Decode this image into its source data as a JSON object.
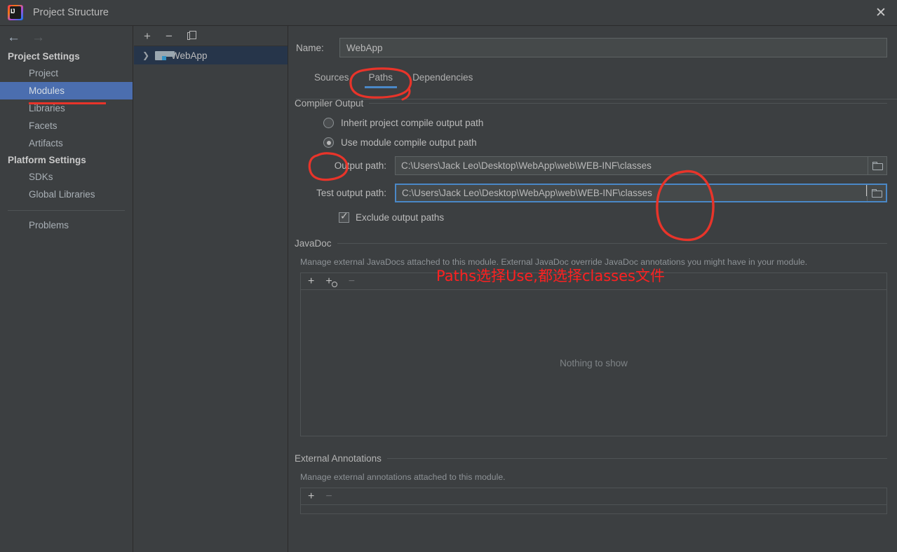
{
  "window": {
    "title": "Project Structure",
    "logo_icon": "intellij-idea-logo",
    "close_icon": "close-icon"
  },
  "sidebar": {
    "back_icon": "arrow-left-icon",
    "forward_icon": "arrow-right-icon",
    "groups": [
      {
        "label": "Project Settings",
        "items": [
          {
            "label": "Project",
            "selected": false
          },
          {
            "label": "Modules",
            "selected": true
          },
          {
            "label": "Libraries",
            "selected": false
          },
          {
            "label": "Facets",
            "selected": false
          },
          {
            "label": "Artifacts",
            "selected": false
          }
        ]
      },
      {
        "label": "Platform Settings",
        "items": [
          {
            "label": "SDKs",
            "selected": false
          },
          {
            "label": "Global Libraries",
            "selected": false
          }
        ]
      }
    ],
    "problems_label": "Problems"
  },
  "tree_panel": {
    "toolbar": {
      "add_icon": "plus-icon",
      "remove_icon": "minus-icon",
      "copy_icon": "copy-icon"
    },
    "nodes": [
      {
        "label": "WebApp",
        "expand_icon": "chevron-right-icon",
        "module_icon": "module-folder-icon",
        "selected": true
      }
    ]
  },
  "main": {
    "name_label": "Name:",
    "name_value": "WebApp",
    "tabs": [
      {
        "label": "Sources",
        "active": false
      },
      {
        "label": "Paths",
        "active": true
      },
      {
        "label": "Dependencies",
        "active": false
      }
    ],
    "compiler_output": {
      "title": "Compiler Output",
      "options": [
        {
          "label": "Inherit project compile output path",
          "selected": false
        },
        {
          "label": "Use module compile output path",
          "selected": true
        }
      ],
      "output_path": {
        "label": "Output path:",
        "value": "C:\\Users\\Jack Leo\\Desktop\\WebApp\\web\\WEB-INF\\classes",
        "focused": false,
        "browse_icon": "folder-browse-icon"
      },
      "test_output_path": {
        "label": "Test output path:",
        "value": "C:\\Users\\Jack Leo\\Desktop\\WebApp\\web\\WEB-INF\\classes",
        "focused": true,
        "browse_icon": "folder-browse-icon"
      },
      "exclude_checkbox": {
        "label": "Exclude output paths",
        "checked": true
      }
    },
    "javadoc": {
      "title": "JavaDoc",
      "description": "Manage external JavaDocs attached to this module. External JavaDoc override JavaDoc annotations you might have in your module.",
      "toolbar": {
        "add_icon": "plus-icon",
        "add_url_icon": "plus-globe-icon",
        "remove_icon": "minus-icon"
      },
      "empty_text": "Nothing to show"
    },
    "external_annotations": {
      "title": "External Annotations",
      "description": "Manage external annotations attached to this module.",
      "toolbar": {
        "add_icon": "plus-icon",
        "remove_icon": "minus-icon"
      }
    }
  },
  "annotations": {
    "color": "#ff2020",
    "note_text": "Paths选择Use,都选择classes文件",
    "circles": [
      "paths-tab-circle",
      "use-module-radio-circle",
      "classes-path-circle"
    ],
    "underlines": [
      "modules-sidebar-underline"
    ]
  }
}
